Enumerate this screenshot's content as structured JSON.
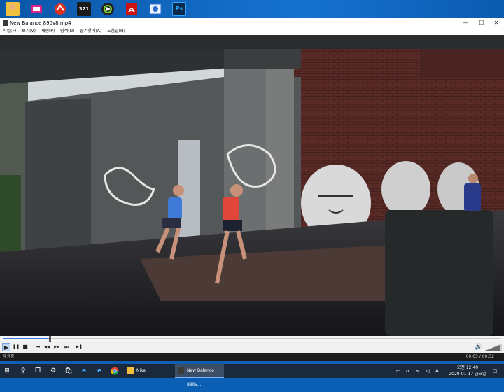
{
  "desktop": {
    "icons": [
      {
        "name": "user-folder-icon",
        "color": "#f0c040"
      },
      {
        "name": "tv-app-icon",
        "color": "#e0208a"
      },
      {
        "name": "ccleaner-icon",
        "color": "#e03020"
      },
      {
        "name": "321-player-icon",
        "color": "#1a1a1a"
      },
      {
        "name": "video-editor-icon",
        "color": "#222222"
      },
      {
        "name": "acrobat-icon",
        "color": "#cc1111"
      },
      {
        "name": "screenshot-tool-icon",
        "color": "#2a6fd0"
      },
      {
        "name": "photoshop-icon",
        "color": "#0a2a4a"
      }
    ],
    "icon_glyphs": {
      "player321": "321",
      "photoshop": "Ps"
    }
  },
  "window": {
    "title": "New Balance 890v8.mp4",
    "minimize": "—",
    "maximize": "☐",
    "close": "✕"
  },
  "menu": [
    "파일(F)",
    "보기(V)",
    "재생(P)",
    "탐색(N)",
    "즐겨찾기(A)",
    "도움말(H)"
  ],
  "playback": {
    "progress": 0.094,
    "status": "재생중",
    "time": "00:03 / 00:32"
  },
  "controls": {
    "play": "▶",
    "pause": "❚❚",
    "stop": "■",
    "prev": "⏮",
    "rewind": "◀◀",
    "forward": "▶▶",
    "next": "⏭",
    "frame": "▶❚",
    "volume_icon": "🔊"
  },
  "taskbar": {
    "start": "⊞",
    "search": "⚲",
    "taskview": "❐",
    "settings": "⚙",
    "store": "🛍",
    "edge": "e",
    "ie": "e",
    "tasks": [
      {
        "label": "Nike",
        "active": false
      },
      {
        "label": "New Balance 890v...",
        "active": true
      }
    ],
    "tray_ime": "A",
    "clock_time": "오전 12:40",
    "clock_date": "2020-01-17 금요일"
  },
  "colors": {
    "accent": "#3a7bd5",
    "taskbar": "#1a2a3c",
    "status_bar": "#1c1c1c"
  }
}
